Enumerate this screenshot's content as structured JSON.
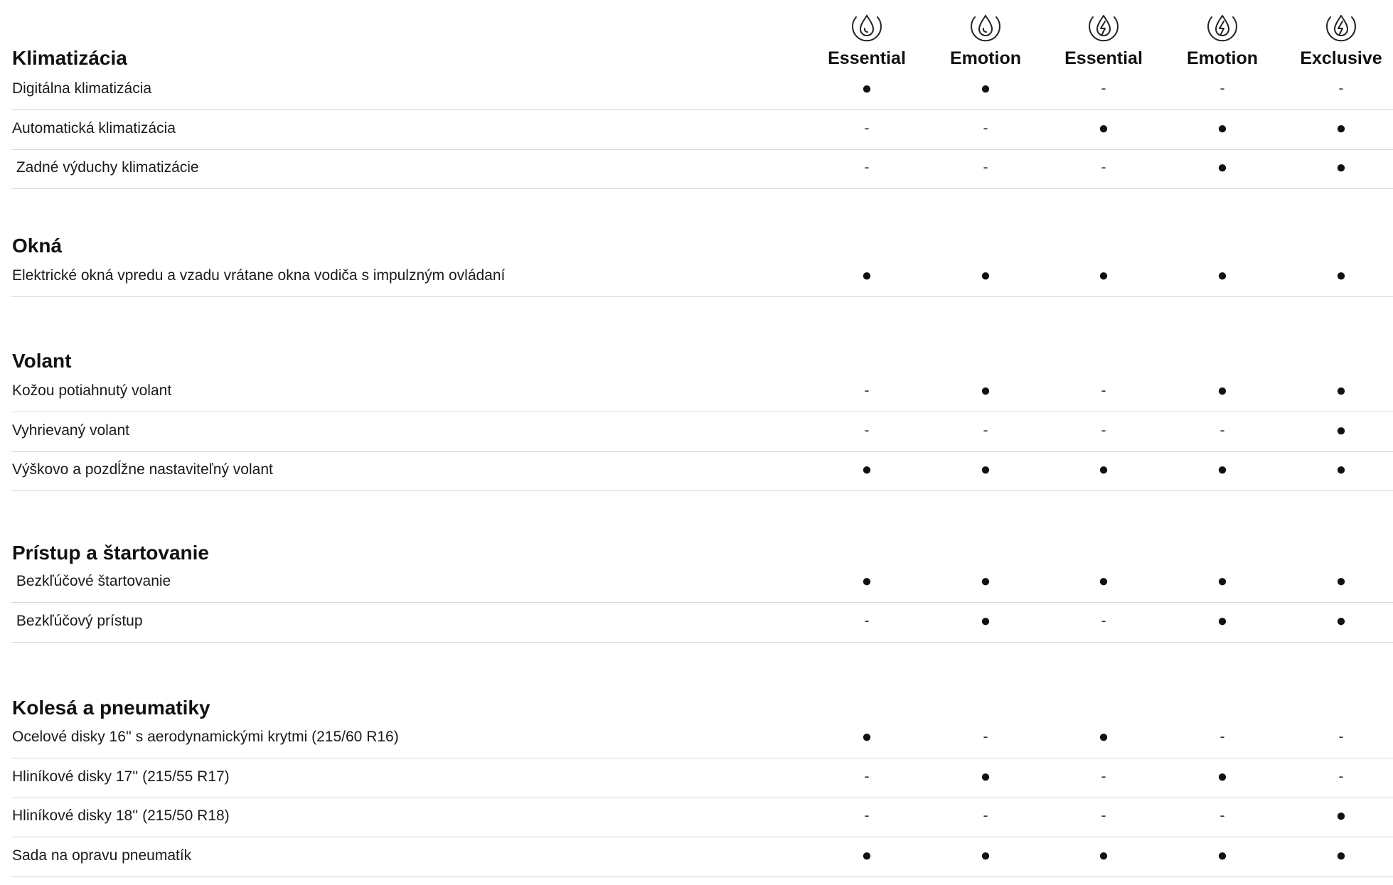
{
  "columns": [
    {
      "label": "Essential",
      "icon": "fuel-drop-icon"
    },
    {
      "label": "Emotion",
      "icon": "fuel-drop-icon"
    },
    {
      "label": "Essential",
      "icon": "hybrid-bolt-icon"
    },
    {
      "label": "Emotion",
      "icon": "hybrid-bolt-icon"
    },
    {
      "label": "Exclusive",
      "icon": "hybrid-bolt-icon"
    }
  ],
  "marks": {
    "yes": "●",
    "no": "-"
  },
  "sections": [
    {
      "title": "Klimatizácia",
      "rows": [
        {
          "label": "Digitálna klimatizácia",
          "values": [
            "yes",
            "yes",
            "no",
            "no",
            "no"
          ]
        },
        {
          "label": "Automatická klimatizácia",
          "values": [
            "no",
            "no",
            "yes",
            "yes",
            "yes"
          ]
        },
        {
          "label": " Zadné výduchy klimatizácie",
          "values": [
            "no",
            "no",
            "no",
            "yes",
            "yes"
          ]
        }
      ]
    },
    {
      "title": "Okná",
      "rows": [
        {
          "label": "Elektrické okná vpredu a vzadu vrátane okna vodiča s impulzným ovládaní",
          "values": [
            "yes",
            "yes",
            "yes",
            "yes",
            "yes"
          ]
        }
      ]
    },
    {
      "title": "Volant",
      "rows": [
        {
          "label": "Kožou potiahnutý volant",
          "values": [
            "no",
            "yes",
            "no",
            "yes",
            "yes"
          ]
        },
        {
          "label": "Vyhrievaný volant",
          "values": [
            "no",
            "no",
            "no",
            "no",
            "yes"
          ]
        },
        {
          "label": "Výškovo a pozdĺžne nastaviteľný volant",
          "values": [
            "yes",
            "yes",
            "yes",
            "yes",
            "yes"
          ]
        }
      ]
    },
    {
      "title": "Prístup a štartovanie",
      "rows": [
        {
          "label": " Bezkľúčové štartovanie",
          "values": [
            "yes",
            "yes",
            "yes",
            "yes",
            "yes"
          ]
        },
        {
          "label": " Bezkľúčový prístup",
          "values": [
            "no",
            "yes",
            "no",
            "yes",
            "yes"
          ]
        }
      ]
    },
    {
      "title": "Kolesá a pneumatiky",
      "rows": [
        {
          "label": "Ocelové disky 16'' s aerodynamickými krytmi (215/60 R16)",
          "values": [
            "yes",
            "no",
            "yes",
            "no",
            "no"
          ]
        },
        {
          "label": "Hliníkové disky 17'' (215/55 R17)",
          "values": [
            "no",
            "yes",
            "no",
            "yes",
            "no"
          ]
        },
        {
          "label": "Hliníkové disky 18'' (215/50 R18)",
          "values": [
            "no",
            "no",
            "no",
            "no",
            "yes"
          ]
        },
        {
          "label": "Sada na opravu pneumatík",
          "values": [
            "yes",
            "yes",
            "yes",
            "yes",
            "yes"
          ]
        }
      ]
    }
  ]
}
